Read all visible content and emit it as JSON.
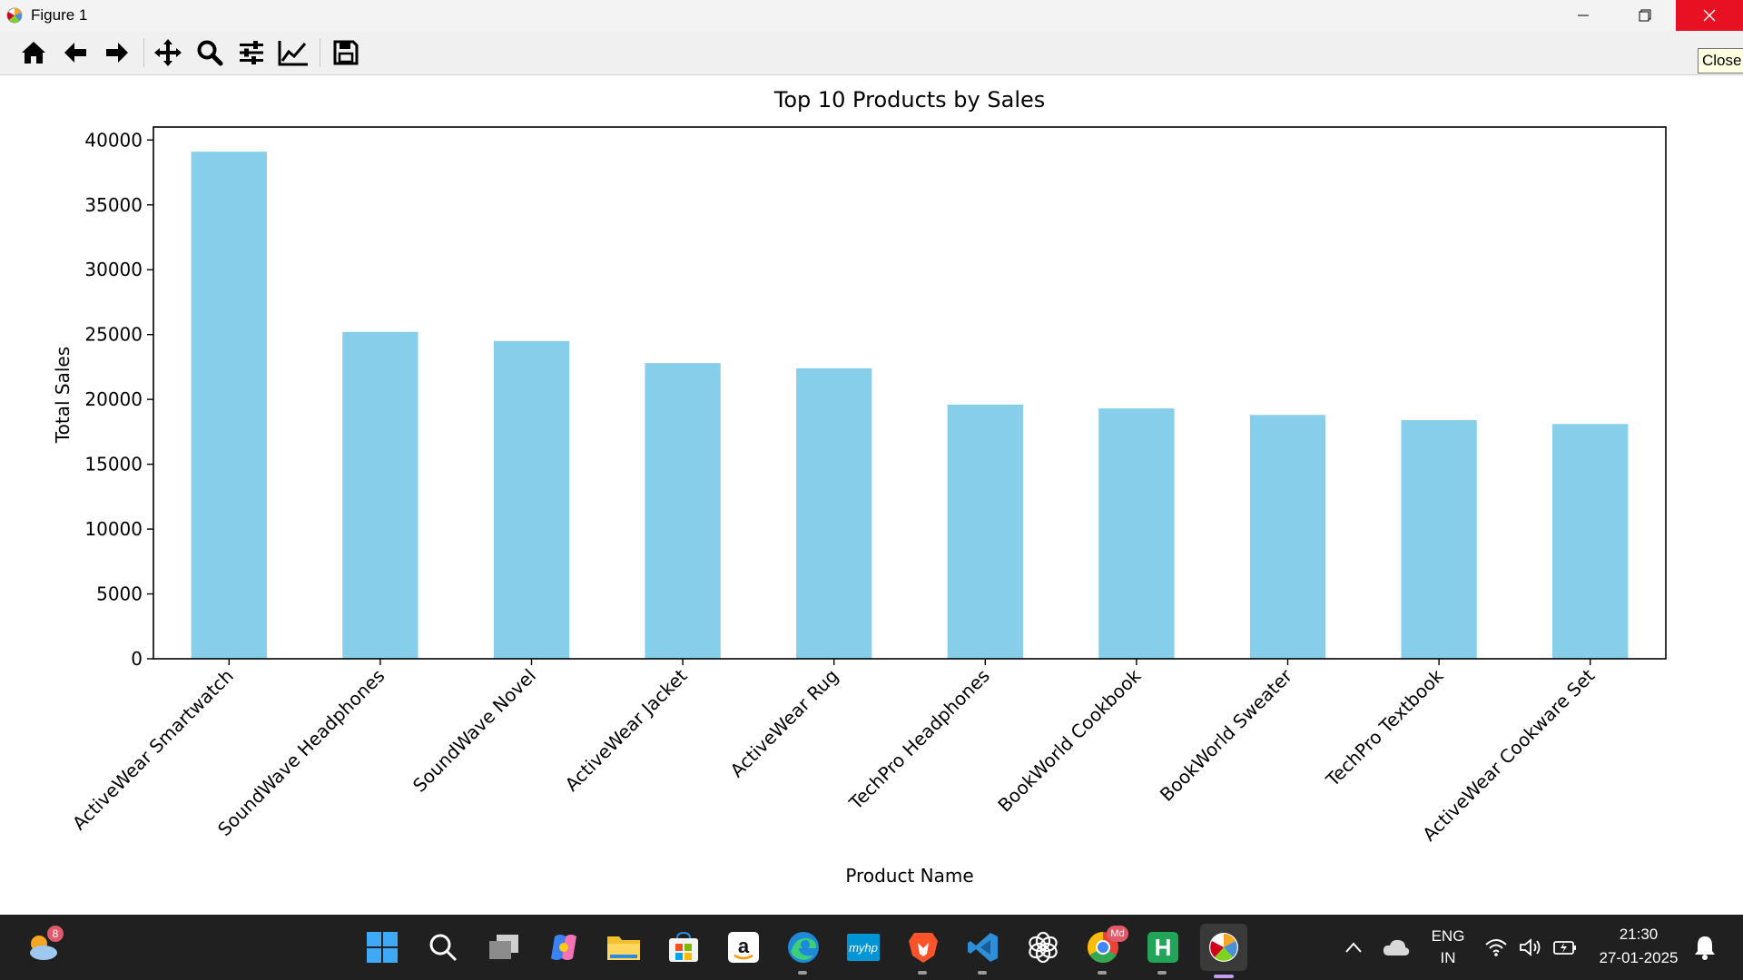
{
  "window": {
    "title": "Figure 1",
    "close_tooltip": "Close"
  },
  "toolbar": {
    "buttons": [
      "home",
      "back",
      "forward",
      "pan",
      "zoom",
      "configure-subplots",
      "edit-axis",
      "save"
    ]
  },
  "chart_data": {
    "type": "bar",
    "title": "Top 10 Products by Sales",
    "xlabel": "Product Name",
    "ylabel": "Total Sales",
    "categories": [
      "ActiveWear Smartwatch",
      "SoundWave Headphones",
      "SoundWave Novel",
      "ActiveWear Jacket",
      "ActiveWear Rug",
      "TechPro Headphones",
      "BookWorld Cookbook",
      "BookWorld Sweater",
      "TechPro Textbook",
      "ActiveWear Cookware Set"
    ],
    "values": [
      39100,
      25200,
      24500,
      22800,
      22400,
      19600,
      19300,
      18800,
      18400,
      18100
    ],
    "ylim": [
      0,
      41000
    ],
    "yticks": [
      0,
      5000,
      10000,
      15000,
      20000,
      25000,
      30000,
      35000,
      40000
    ],
    "bar_color": "#87ceeb",
    "grid": false
  },
  "taskbar": {
    "weather_badge": "8",
    "apps": [
      "start",
      "search",
      "task-view",
      "copilot",
      "file-explorer",
      "microsoft-store",
      "amazon",
      "edge",
      "myhp",
      "brave",
      "vscode",
      "chatgpt",
      "chrome",
      "hotel-app",
      "matplotlib-figure"
    ],
    "chrome_badge": "Md",
    "language": "ENG",
    "region": "IN",
    "time": "21:30",
    "date": "27-01-2025"
  }
}
